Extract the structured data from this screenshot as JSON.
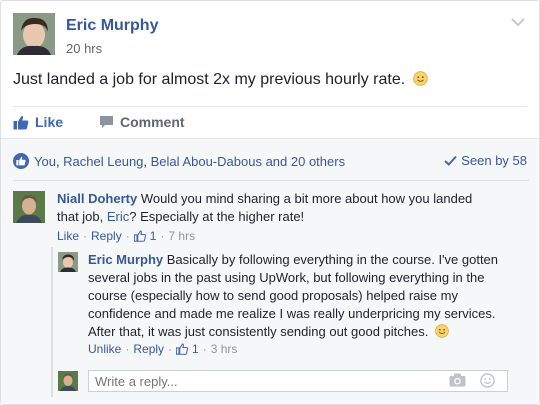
{
  "post": {
    "author": "Eric Murphy",
    "time": "20 hrs",
    "text": "Just landed a job for almost 2x my previous hourly rate.",
    "like_label": "Like",
    "comment_label": "Comment"
  },
  "reactions": {
    "you": "You",
    "names": [
      "Rachel Leung",
      "Belal Abou-Dabous"
    ],
    "others": "and 20 others",
    "seen_label": "Seen by 58"
  },
  "comments": [
    {
      "author": "Niall Doherty",
      "text_part1": "Would you mind sharing a bit more about how you landed that job,",
      "mention": "Eric",
      "text_part2": "? Especially at the higher rate!",
      "like_label": "Like",
      "reply_label": "Reply",
      "like_count": "1",
      "time": "7 hrs",
      "replies": [
        {
          "author": "Eric Murphy",
          "text": "Basically by following everything in the course. I've gotten several jobs in the past using UpWork, but following everything in the course (especially how to send good proposals) helped raise my confidence and made me realize I was really underpricing my services. After that, it was just consistently sending out good pitches.",
          "like_label": "Unlike",
          "reply_label": "Reply",
          "like_count": "1",
          "time": "3 hrs"
        }
      ]
    }
  ],
  "reply_box": {
    "placeholder": "Write a reply..."
  },
  "icons": {
    "post_menu": "chevron-down-icon",
    "like": "thumbs-up-icon",
    "comment": "comment-icon",
    "like_badge": "like-badge-icon",
    "seen": "checkmark-icon",
    "emoji": "smiley-icon",
    "camera": "camera-icon",
    "sticker": "sticker-icon"
  },
  "colors": {
    "link": "#365899",
    "brand": "#4267b2",
    "meta": "#90949c",
    "ufi_bg": "#f6f7f9"
  }
}
